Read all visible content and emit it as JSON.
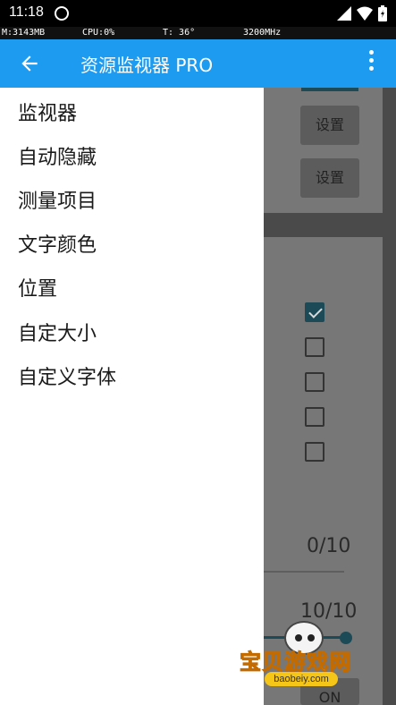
{
  "status_bar": {
    "time": "11:18"
  },
  "monitor": {
    "memory": "M:3143MB",
    "cpu": "CPU:0%",
    "temp": "T: 36°",
    "freq": "3200MHz"
  },
  "app_bar": {
    "title": "资源监视器 PRO"
  },
  "background": {
    "settings_label_1": "设置",
    "settings_label_2": "设置",
    "checkbox_checked": [
      true,
      false,
      false,
      false,
      false
    ],
    "count_top": "0/10",
    "count_bottom": "10/10",
    "slider_value": 1.0,
    "bottom_button": "ON"
  },
  "drawer": {
    "items": [
      {
        "label": "监视器"
      },
      {
        "label": "自动隐藏"
      },
      {
        "label": "测量项目"
      },
      {
        "label": "文字颜色"
      },
      {
        "label": "位置"
      },
      {
        "label": "自定大小"
      },
      {
        "label": "自定义字体"
      }
    ]
  },
  "watermark": {
    "text": "宝贝游戏网",
    "url": "baobeiy.com"
  },
  "colors": {
    "app_bar": "#1d9bf0",
    "accent_dim": "#1c4a57",
    "watermark": "#f5a623"
  }
}
